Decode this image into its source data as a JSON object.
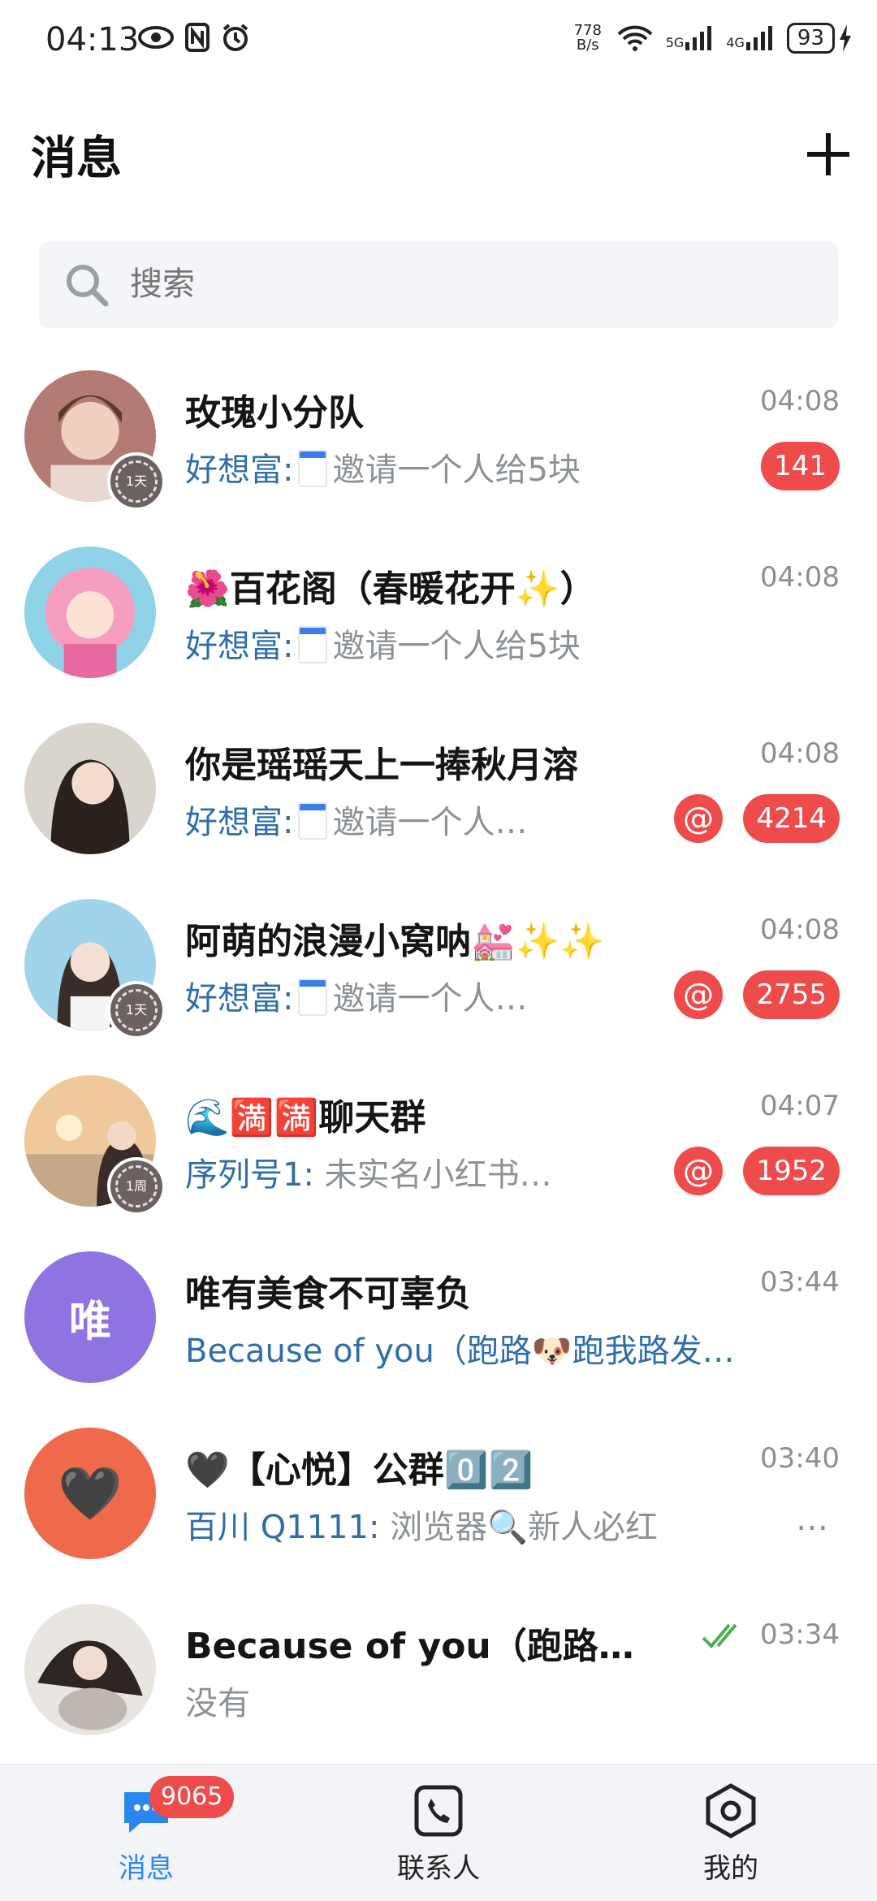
{
  "status_bar": {
    "time": "04:13",
    "net_speed_top": "778",
    "net_speed_bottom": "B/s",
    "battery": "93",
    "sig1": "5G",
    "sig2": "4G"
  },
  "header": {
    "title": "消息"
  },
  "search": {
    "placeholder": "搜索"
  },
  "chats": [
    {
      "name": "玫瑰小分队",
      "time": "04:08",
      "sender": "好想富:",
      "text": "邀请一个人给5块",
      "count": "141",
      "timer": "1天"
    },
    {
      "name": "🌺百花阁（春暖花开✨）",
      "time": "04:08",
      "sender": "好想富:",
      "text": "邀请一个人给5块"
    },
    {
      "name": "你是瑶瑶天上一捧秋月溶",
      "time": "04:08",
      "sender": "好想富:",
      "text": "邀请一个人…",
      "count": "4214",
      "mention": "@"
    },
    {
      "name": "阿萌的浪漫小窝呐💒✨✨",
      "time": "04:08",
      "sender": "好想富:",
      "text": "邀请一个人…",
      "count": "2755",
      "mention": "@",
      "timer": "1天"
    },
    {
      "name": "🌊🈵🈵聊天群",
      "time": "04:07",
      "sender": "序列号1:",
      "text": "未实名小红书…",
      "count": "1952",
      "mention": "@",
      "timer": "1周"
    },
    {
      "name": "唯有美食不可辜负",
      "time": "03:44",
      "avatar_text": "唯",
      "text": "Because of you（跑路🐶跑我路发…"
    },
    {
      "name": "🖤【心悦】公群0️⃣2️⃣",
      "time": "03:40",
      "avatar_text": "🖤",
      "sender": "百川 Q1111:",
      "text": "浏览器🔍新人必红",
      "trail": "…"
    },
    {
      "name": "Because of you（跑路…",
      "time": "03:34",
      "text": "没有"
    }
  ],
  "nav": {
    "messages_label": "消息",
    "messages_badge": "9065",
    "contacts_label": "联系人",
    "me_label": "我的"
  },
  "colors": {
    "accent": "#2b86f0",
    "badge": "#ee4b4b",
    "sender": "#2f6ea8"
  }
}
